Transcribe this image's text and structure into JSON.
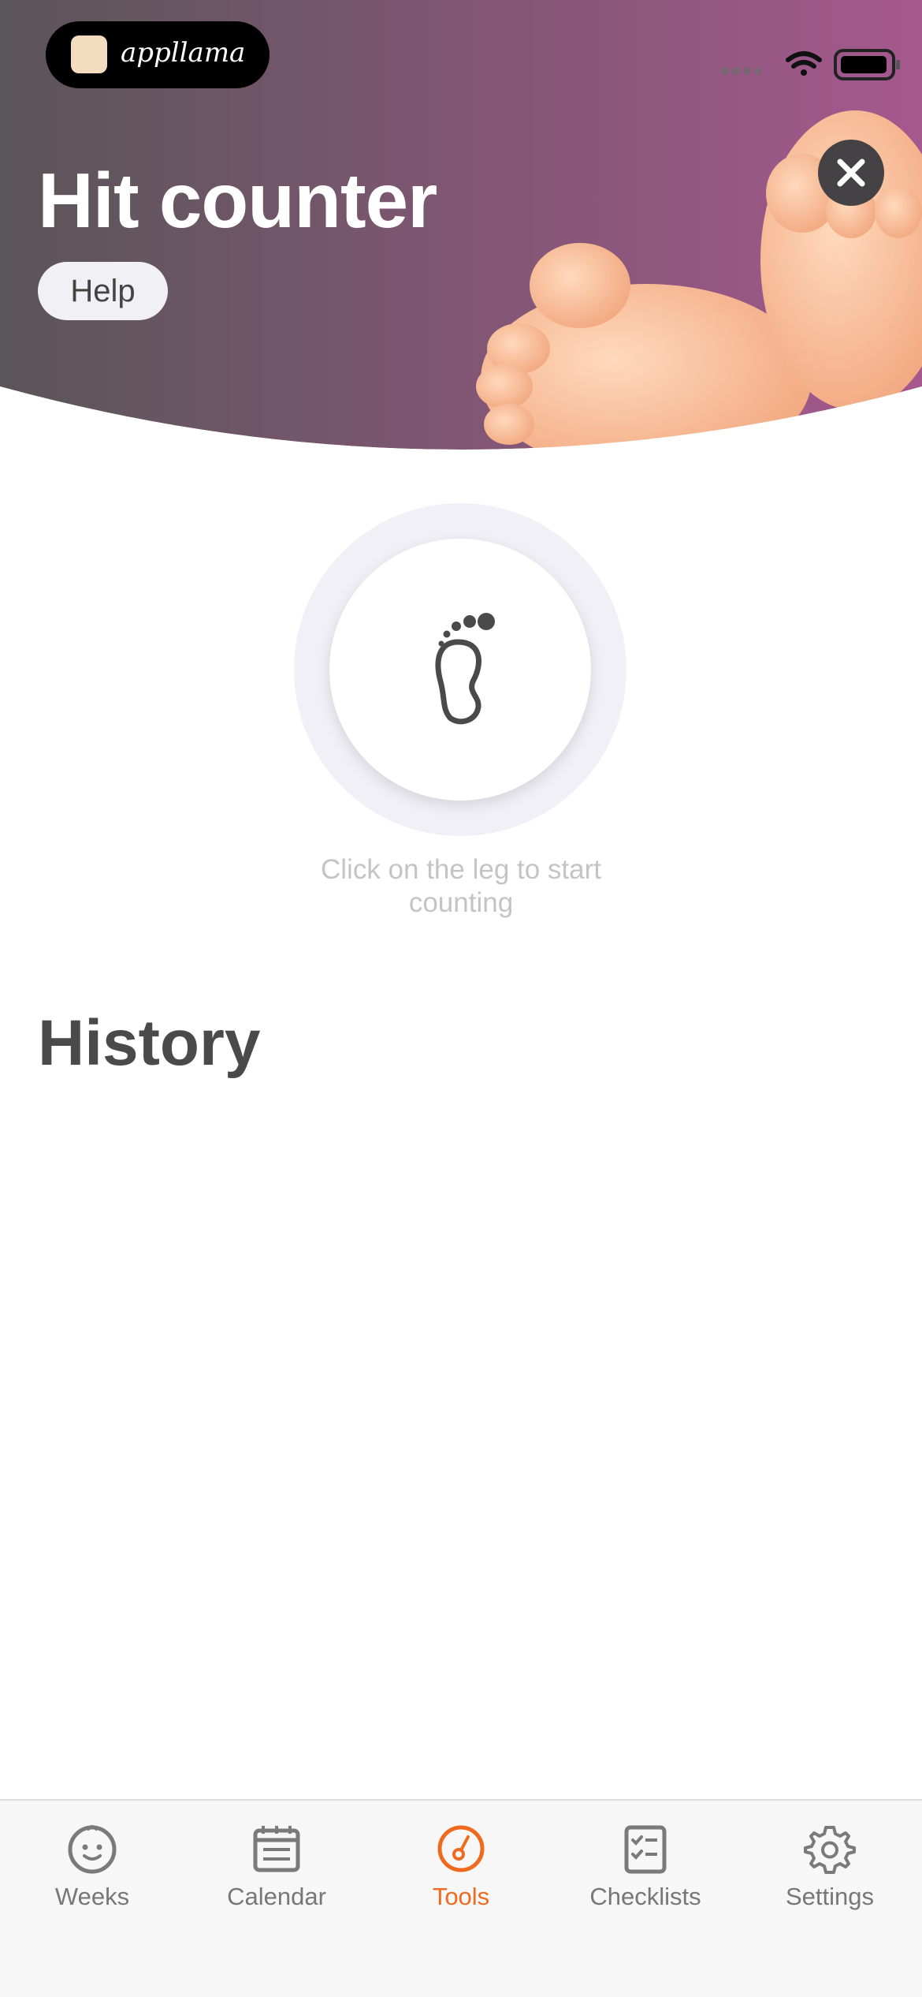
{
  "brand": {
    "name": "appllama"
  },
  "header": {
    "title": "Hit counter",
    "help_label": "Help"
  },
  "counter": {
    "hint": "Click on the leg to start counting"
  },
  "history": {
    "title": "History"
  },
  "tabs": [
    {
      "label": "Weeks",
      "icon": "baby-face-icon",
      "active": false
    },
    {
      "label": "Calendar",
      "icon": "calendar-icon",
      "active": false
    },
    {
      "label": "Tools",
      "icon": "gauge-icon",
      "active": true
    },
    {
      "label": "Checklists",
      "icon": "checklist-icon",
      "active": false
    },
    {
      "label": "Settings",
      "icon": "gear-icon",
      "active": false
    }
  ],
  "colors": {
    "accent": "#ef6a1e",
    "header_gradient_start": "#5a5558",
    "header_gradient_end": "#a5588e"
  }
}
